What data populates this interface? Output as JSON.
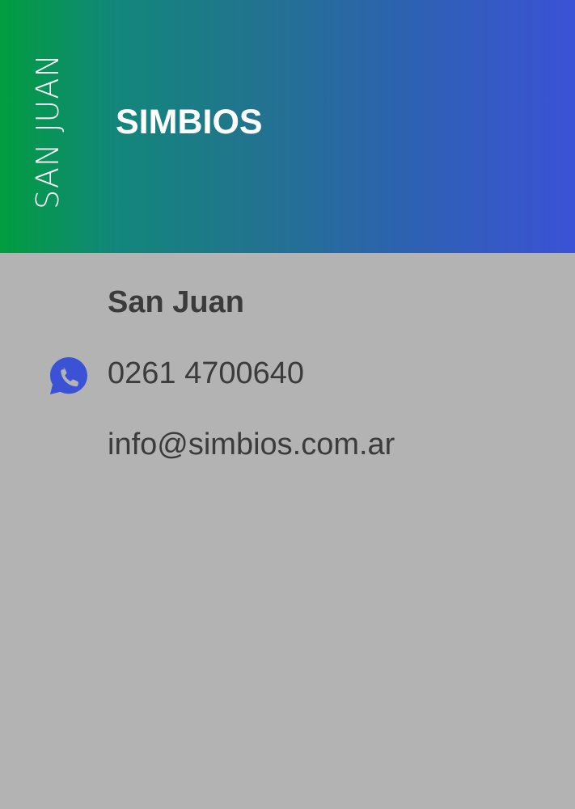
{
  "header": {
    "region_label": "SAN JUAN",
    "brand_title": "SIMBIOS"
  },
  "contact": {
    "city": "San Juan",
    "phone": "0261 4700640",
    "email": "info@simbios.com.ar",
    "phone_icon": "whatsapp-icon"
  },
  "colors": {
    "gradient_start": "#019d3f",
    "gradient_end": "#3b52d6",
    "background": "#b3b3b3",
    "text": "#3b3b3b",
    "icon": "#3b52d6"
  }
}
